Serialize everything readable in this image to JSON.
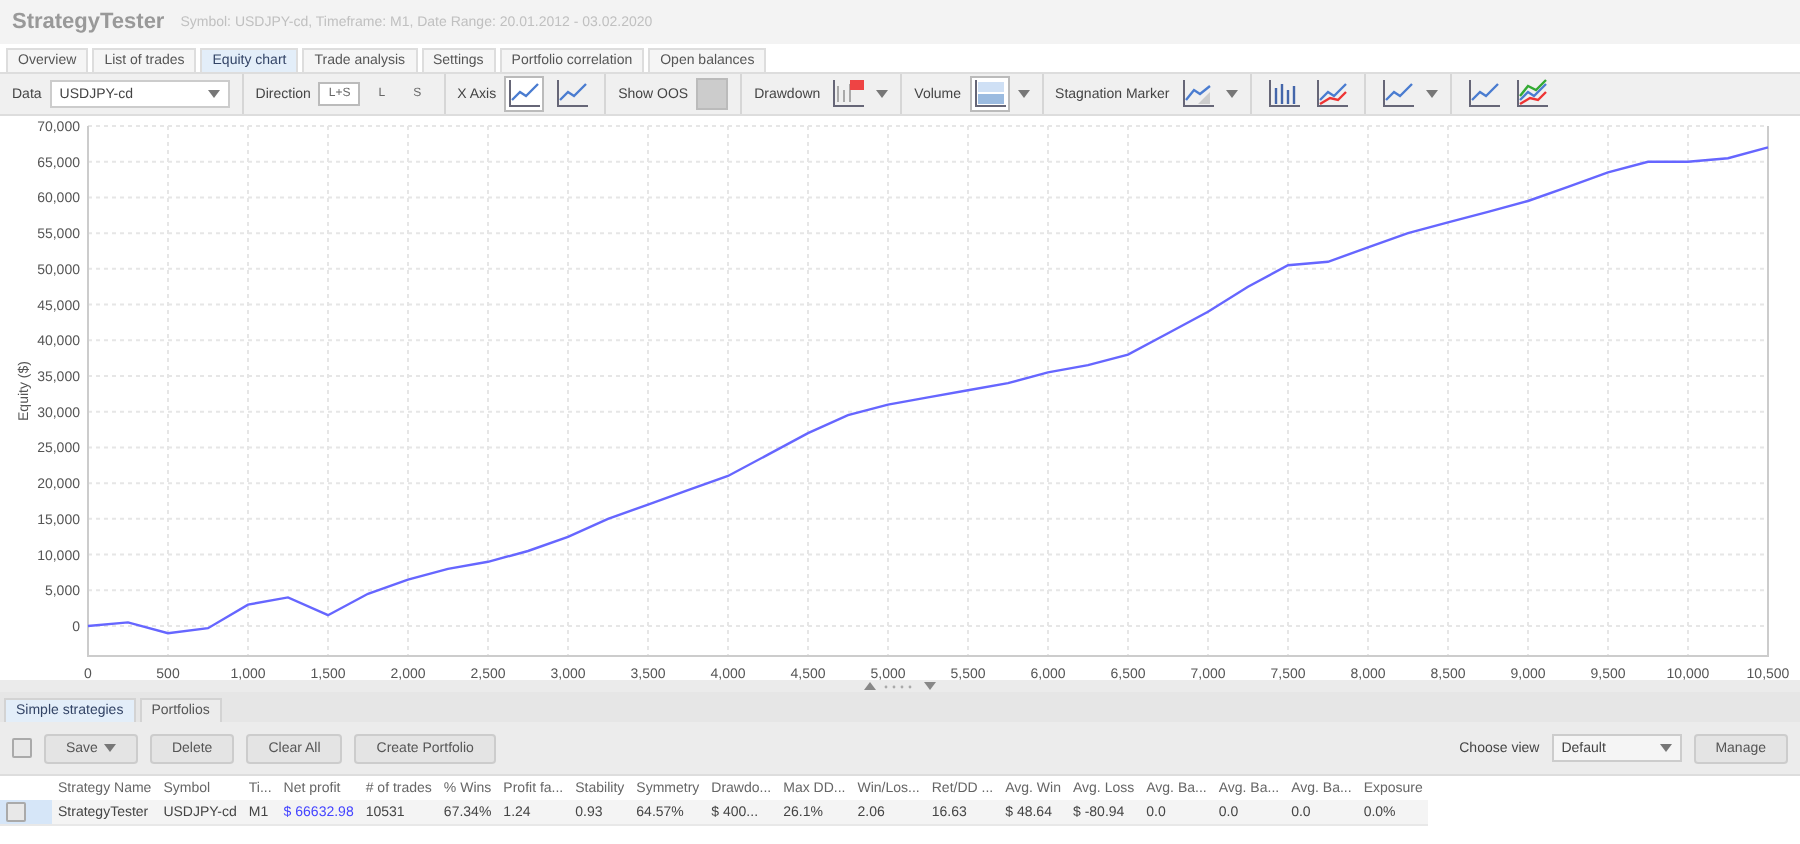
{
  "window": {
    "title": "StrategyTester",
    "subtitle": "Symbol: USDJPY-cd, Timeframe: M1, Date Range: 20.01.2012 - 03.02.2020"
  },
  "tabs": [
    {
      "label": "Overview",
      "selected": false
    },
    {
      "label": "List of trades",
      "selected": false
    },
    {
      "label": "Equity chart",
      "selected": true
    },
    {
      "label": "Trade analysis",
      "selected": false
    },
    {
      "label": "Settings",
      "selected": false
    },
    {
      "label": "Portfolio correlation",
      "selected": false
    },
    {
      "label": "Open balances",
      "selected": false
    }
  ],
  "toolbar": {
    "data": {
      "label": "Data",
      "value": "USDJPY-cd"
    },
    "direction": {
      "label": "Direction",
      "options": [
        {
          "label": "L+S",
          "selected": true
        },
        {
          "label": "L",
          "selected": false
        },
        {
          "label": "S",
          "selected": false
        }
      ]
    },
    "x_axis": {
      "label": "X Axis",
      "options": [
        {
          "selected": true
        },
        {
          "selected": false
        }
      ]
    },
    "show_oos": {
      "label": "Show OOS",
      "on": false
    },
    "drawdown": {
      "label": "Drawdown"
    },
    "volume": {
      "label": "Volume"
    },
    "stagnation_marker": {
      "label": "Stagnation Marker"
    }
  },
  "chart": {
    "chart_data": {
      "type": "line",
      "ylabel": "Equity ($)",
      "x": [
        0,
        250,
        500,
        750,
        1000,
        1250,
        1500,
        1750,
        2000,
        2250,
        2500,
        2750,
        3000,
        3250,
        3500,
        3750,
        4000,
        4250,
        4500,
        4750,
        5000,
        5250,
        5500,
        5750,
        6000,
        6250,
        6500,
        6750,
        7000,
        7250,
        7500,
        7750,
        8000,
        8250,
        8500,
        8750,
        9000,
        9250,
        9500,
        9750,
        10000,
        10250,
        10500
      ],
      "series": [
        {
          "color": "#6666ff",
          "values": [
            0,
            500,
            -1000,
            -300,
            3000,
            4000,
            1500,
            4500,
            6500,
            8000,
            9000,
            10500,
            12500,
            15000,
            17000,
            19000,
            21000,
            24000,
            27000,
            29500,
            31000,
            32000,
            33000,
            34000,
            35500,
            36500,
            38000,
            41000,
            44000,
            47500,
            50500,
            51000,
            53000,
            55000,
            56500,
            58000,
            59500,
            61500,
            63500,
            65000,
            65000,
            65500,
            67000
          ]
        }
      ],
      "xlim": [
        0,
        10500
      ],
      "ylim": [
        -4200,
        70000
      ],
      "xticks": [
        0,
        {
          "value": 500,
          "label": "500"
        },
        {
          "value": 1000,
          "label": "1,000"
        },
        {
          "value": 1500,
          "label": "1,500"
        },
        {
          "value": 2000,
          "label": "2,000"
        },
        {
          "value": 2500,
          "label": "2,500"
        },
        {
          "value": 3000,
          "label": "3,000"
        },
        {
          "value": 3500,
          "label": "3,500"
        },
        {
          "value": 4000,
          "label": "4,000"
        },
        {
          "value": 4500,
          "label": "4,500"
        },
        {
          "value": 5000,
          "label": "5,000"
        },
        {
          "value": 5500,
          "label": "5,500"
        },
        {
          "value": 6000,
          "label": "6,000"
        },
        {
          "value": 6500,
          "label": "6,500"
        },
        {
          "value": 7000,
          "label": "7,000"
        },
        {
          "value": 7500,
          "label": "7,500"
        },
        {
          "value": 8000,
          "label": "8,000"
        },
        {
          "value": 8500,
          "label": "8,500"
        },
        {
          "value": 9000,
          "label": "9,000"
        },
        {
          "value": 9500,
          "label": "9,500"
        },
        {
          "value": 10000,
          "label": "10,000"
        },
        {
          "value": 10500,
          "label": "10,500"
        }
      ],
      "grid": true,
      "yticks": [
        0,
        {
          "value": 5000,
          "label": "5,000"
        },
        {
          "value": 10000,
          "label": "10,000"
        },
        {
          "value": 15000,
          "label": "15,000"
        },
        {
          "value": 20000,
          "label": "20,000"
        },
        {
          "value": 25000,
          "label": "25,000"
        },
        {
          "value": 30000,
          "label": "30,000"
        },
        {
          "value": 35000,
          "label": "35,000"
        },
        {
          "value": 40000,
          "label": "40,000"
        },
        {
          "value": 45000,
          "label": "45,000"
        },
        {
          "value": 50000,
          "label": "50,000"
        },
        {
          "value": 55000,
          "label": "55,000"
        },
        {
          "value": 60000,
          "label": "60,000"
        },
        {
          "value": 65000,
          "label": "65,000"
        },
        {
          "value": 70000,
          "label": "70,000"
        }
      ]
    }
  },
  "bottom_tabs": [
    {
      "label": "Simple strategies",
      "selected": true
    },
    {
      "label": "Portfolios",
      "selected": false
    }
  ],
  "actions": {
    "select_all": {
      "checked": false
    },
    "buttons": [
      "Save",
      "Delete",
      "Clear All",
      "Create Portfolio"
    ],
    "choose_view": {
      "label": "Choose view",
      "value": "Default"
    },
    "manage": "Manage"
  },
  "table": {
    "columns": [
      "Strategy Name",
      "Symbol",
      "Ti...",
      "Net profit",
      "# of trades",
      "% Wins",
      "Profit fa...",
      "Stability",
      "Symmetry",
      "Drawdo...",
      "Max DD...",
      "Win/Los...",
      "Ret/DD ...",
      "Avg. Win",
      "Avg. Loss",
      "Avg. Ba...",
      "Avg. Ba...",
      "Avg. Ba...",
      "Exposure"
    ],
    "rows": [
      {
        "checked": false,
        "selected": true,
        "cells": [
          "StrategyTester",
          "USDJPY-cd",
          "M1",
          "$ 66632.98",
          "10531",
          "67.34%",
          "1.24",
          "0.93",
          "64.57%",
          "$ 400...",
          "26.1%",
          "2.06",
          "16.63",
          "$ 48.64",
          "$ -80.94",
          "0.0",
          "0.0",
          "0.0",
          "0.0%"
        ]
      }
    ]
  }
}
